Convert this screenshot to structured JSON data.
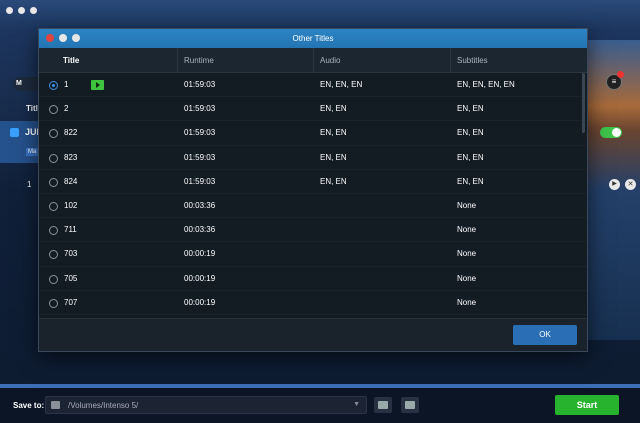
{
  "background_app": {
    "toolbar_pill_label": "M",
    "title_column_label": "Title",
    "disc_name": "JUN",
    "disc_tag": "Ma",
    "row_number": "1",
    "list_badge": "1"
  },
  "dialog": {
    "title": "Other Titles",
    "columns": [
      "Title",
      "Runtime",
      "Audio",
      "Subtitles"
    ],
    "rows": [
      {
        "title": "1",
        "runtime": "01:59:03",
        "audio": "EN, EN, EN",
        "subtitles": "EN, EN, EN, EN",
        "selected": true,
        "has_play_badge": true
      },
      {
        "title": "2",
        "runtime": "01:59:03",
        "audio": "EN, EN",
        "subtitles": "EN, EN",
        "selected": false,
        "has_play_badge": false
      },
      {
        "title": "822",
        "runtime": "01:59:03",
        "audio": "EN, EN",
        "subtitles": "EN, EN",
        "selected": false,
        "has_play_badge": false
      },
      {
        "title": "823",
        "runtime": "01:59:03",
        "audio": "EN, EN",
        "subtitles": "EN, EN",
        "selected": false,
        "has_play_badge": false
      },
      {
        "title": "824",
        "runtime": "01:59:03",
        "audio": "EN, EN",
        "subtitles": "EN, EN",
        "selected": false,
        "has_play_badge": false
      },
      {
        "title": "102",
        "runtime": "00:03:36",
        "audio": "",
        "subtitles": "None",
        "selected": false,
        "has_play_badge": false
      },
      {
        "title": "711",
        "runtime": "00:03:36",
        "audio": "",
        "subtitles": "None",
        "selected": false,
        "has_play_badge": false
      },
      {
        "title": "703",
        "runtime": "00:00:19",
        "audio": "",
        "subtitles": "None",
        "selected": false,
        "has_play_badge": false
      },
      {
        "title": "705",
        "runtime": "00:00:19",
        "audio": "",
        "subtitles": "None",
        "selected": false,
        "has_play_badge": false
      },
      {
        "title": "707",
        "runtime": "00:00:19",
        "audio": "",
        "subtitles": "None",
        "selected": false,
        "has_play_badge": false
      }
    ],
    "ok_label": "OK"
  },
  "bottom_bar": {
    "save_to_label": "Save to:",
    "save_path": "/Volumes/Intenso 5/",
    "start_label": "Start"
  },
  "colors": {
    "accent_blue": "#2a6fb6",
    "titlebar_blue": "#2c84c4",
    "start_green": "#27b32e",
    "play_badge_green": "#3fc43f",
    "close_red": "#e0443e"
  }
}
